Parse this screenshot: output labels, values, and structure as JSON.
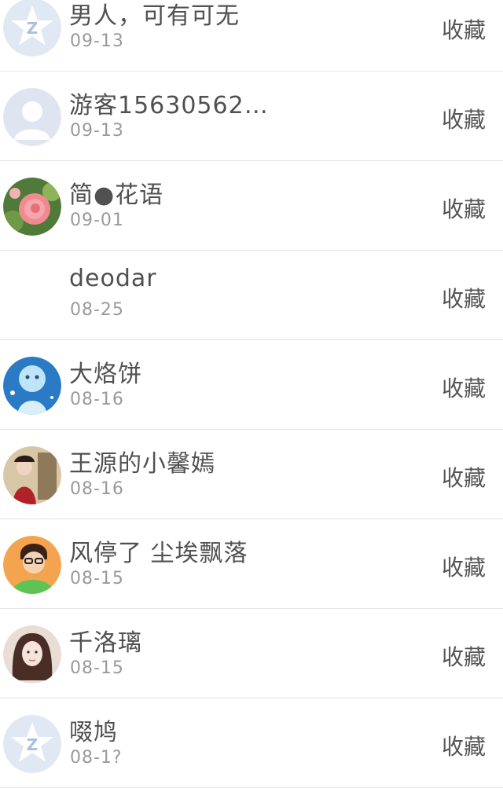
{
  "favorite_label": "收藏",
  "users": [
    {
      "name": "男人，可有可无",
      "date": "09-13",
      "avatar": "qzone-default-avatar-icon"
    },
    {
      "name": "游客15630562…",
      "date": "09-13",
      "avatar": "default-person-avatar-icon"
    },
    {
      "name": "简●花语",
      "date": "09-01",
      "avatar": "rose-photo-avatar"
    },
    {
      "name": "deodar",
      "date": "08-25",
      "avatar": "none"
    },
    {
      "name": "大烙饼",
      "date": "08-16",
      "avatar": "blue-cartoon-avatar"
    },
    {
      "name": "王源的小馨嫣",
      "date": "08-16",
      "avatar": "costume-figure-avatar"
    },
    {
      "name": "风停了 尘埃飘落",
      "date": "08-15",
      "avatar": "boy-glasses-avatar"
    },
    {
      "name": "千洛璃",
      "date": "08-15",
      "avatar": "girl-portrait-avatar"
    },
    {
      "name": "啜鸠",
      "date": "08-1?",
      "avatar": "qzone-default-avatar-icon"
    }
  ]
}
